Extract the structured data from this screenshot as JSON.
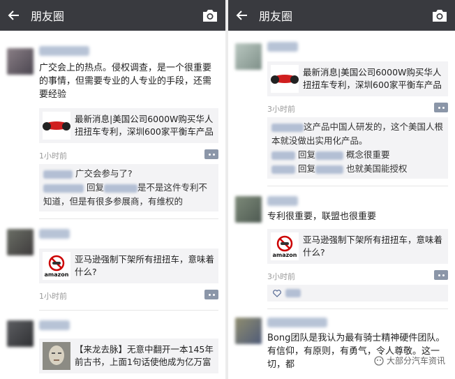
{
  "colors": {
    "topbar": "#393a3f",
    "link": "#576b95",
    "time": "#9a9a9a"
  },
  "left": {
    "header": {
      "title": "朋友圈",
      "back_icon": "arrow-left",
      "camera_icon": "camera"
    },
    "posts": [
      {
        "text": "广交会上的热点。侵权调查，是一个很重要的事情，但需要专业的人专业的手段，还需要经验",
        "share_title": "最新消息|美国公司6000W购买华人扭扭车专利，深圳600家平衡车产品",
        "time": "1小时前",
        "comments": [
          {
            "text": "广交会参与了?"
          },
          {
            "reply": "回复",
            "text": "是不是这件专利不知道，但是有很多参展商，有维权的"
          }
        ]
      },
      {
        "share_title": "亚马逊强制下架所有扭扭车，意味着什么?",
        "amazon_label": "amazon",
        "time": "1小时前"
      },
      {
        "share_title": "【来龙去脉】无意中翻开一本145年前古书，上面1句话使他成为亿万富"
      }
    ]
  },
  "right": {
    "header": {
      "title": "朋友圈",
      "back_icon": "arrow-left",
      "camera_icon": "camera"
    },
    "posts": [
      {
        "share_title": "最新消息|美国公司6000W购买华人扭扭车专利，深圳600家平衡车产品",
        "time": "3小时前",
        "comments": [
          {
            "text": "这产品中国人研发的，这个美国人根本就没做出实用化产品。"
          },
          {
            "reply": "回复",
            "text": "概念很重要"
          },
          {
            "reply": "回复",
            "text": "也就美国能授权"
          }
        ]
      },
      {
        "text": "专利很重要，联盟也很重要",
        "share_title": "亚马逊强制下架所有扭扭车，意味着什么?",
        "amazon_label": "amazon",
        "time": "3小时前"
      },
      {
        "text": "Bong团队是我认为最有骑士精神硬件团队。有信仰，有原则，有勇气，令人尊敬。这一切，都"
      }
    ],
    "watermark": "大部分汽车资讯"
  }
}
